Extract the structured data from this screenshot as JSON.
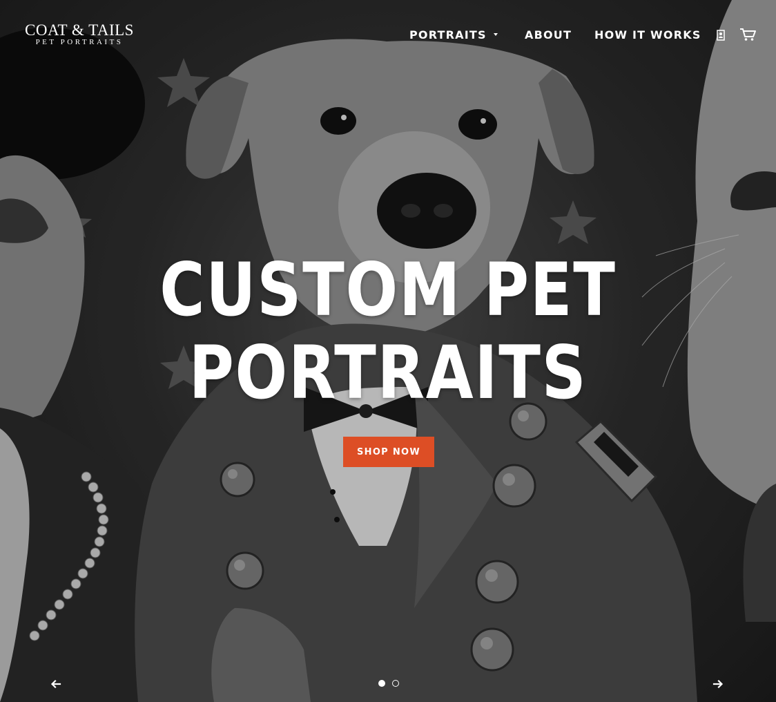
{
  "logo": {
    "main": "COAT & TAILS",
    "sub": "PET PORTRAITS"
  },
  "nav": {
    "items": [
      {
        "label": "PORTRAITS",
        "has_dropdown": true
      },
      {
        "label": "ABOUT"
      },
      {
        "label": "HOW IT WORKS"
      }
    ],
    "account_icon": "account-icon",
    "cart_icon": "cart-icon"
  },
  "hero": {
    "headline_line1": "CUSTOM PET",
    "headline_line2": "PORTRAITS",
    "cta_label": "SHOP NOW",
    "background_image": "grayscale painting of dogs and a cat dressed in historical costumes"
  },
  "slideshow": {
    "prev_icon": "arrow-left-icon",
    "next_icon": "arrow-right-icon",
    "slide_count": 2,
    "active_slide": 1
  },
  "colors": {
    "accent": "#dd4e25",
    "text": "#ffffff",
    "background": "#1a1a1a"
  }
}
